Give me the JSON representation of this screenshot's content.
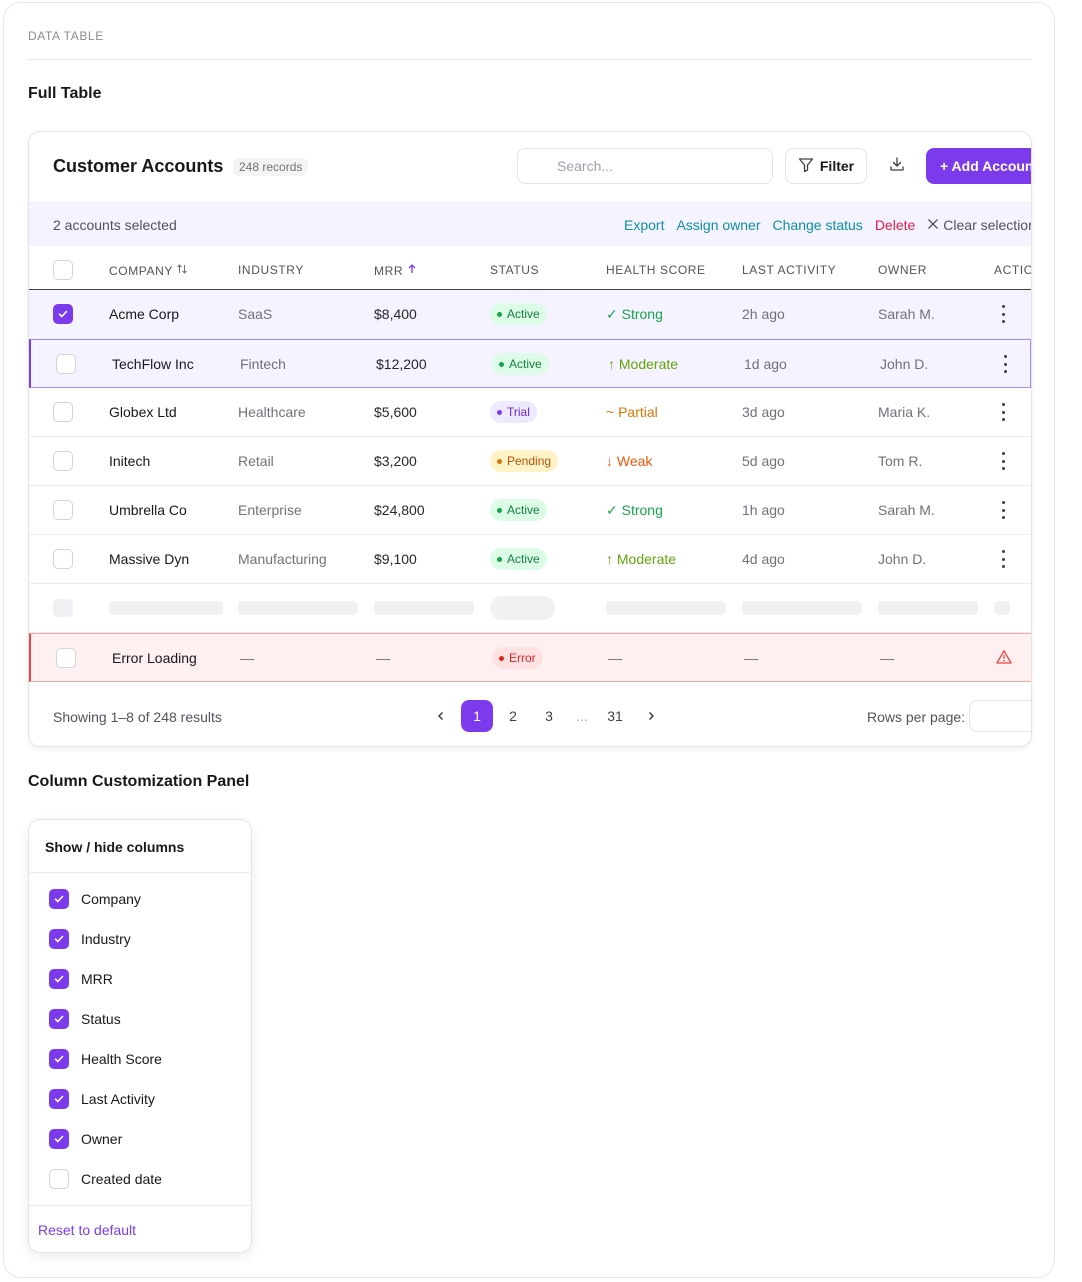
{
  "section": {
    "label": "DATA TABLE"
  },
  "full_table": {
    "heading": "Full Table",
    "title": "Customer Accounts",
    "records": "248 records",
    "search_placeholder": "Search...",
    "filter_label": "Filter",
    "add_label": "+ Add Account"
  },
  "bulk": {
    "count": "2 accounts selected",
    "export": "Export",
    "assign": "Assign owner",
    "change_status": "Change status",
    "delete": "Delete",
    "clear": "Clear selection"
  },
  "columns": {
    "company": "COMPANY",
    "industry": "INDUSTRY",
    "mrr": "MRR",
    "status": "STATUS",
    "health": "HEALTH SCORE",
    "last_activity": "LAST ACTIVITY",
    "owner": "OWNER",
    "actions": "ACTIONS"
  },
  "rows": [
    {
      "company": "Acme Corp",
      "industry": "SaaS",
      "mrr": "$8,400",
      "status": "Active",
      "health": "Strong",
      "last": "2h ago",
      "owner": "Sarah M."
    },
    {
      "company": "TechFlow Inc",
      "industry": "Fintech",
      "mrr": "$12,200",
      "status": "Active",
      "health": "Moderate",
      "last": "1d ago",
      "owner": "John D."
    },
    {
      "company": "Globex Ltd",
      "industry": "Healthcare",
      "mrr": "$5,600",
      "status": "Trial",
      "health": "Partial",
      "last": "3d ago",
      "owner": "Maria K."
    },
    {
      "company": "Initech",
      "industry": "Retail",
      "mrr": "$3,200",
      "status": "Pending",
      "health": "Weak",
      "last": "5d ago",
      "owner": "Tom R."
    },
    {
      "company": "Umbrella Co",
      "industry": "Enterprise",
      "mrr": "$24,800",
      "status": "Active",
      "health": "Strong",
      "last": "1h ago",
      "owner": "Sarah M."
    },
    {
      "company": "Massive Dyn",
      "industry": "Manufacturing",
      "mrr": "$9,100",
      "status": "Active",
      "health": "Moderate",
      "last": "4d ago",
      "owner": "John D."
    }
  ],
  "error_row": {
    "company": "Error Loading",
    "dash": "—",
    "status": "Error"
  },
  "footer": {
    "showing": "Showing 1–8 of 248 results",
    "pages": [
      "1",
      "2",
      "3",
      "...",
      "31"
    ],
    "rows_per_page": "Rows per page:"
  },
  "panel": {
    "heading": "Column Customization Panel",
    "title": "Show / hide columns",
    "options": [
      {
        "label": "Company",
        "checked": true
      },
      {
        "label": "Industry",
        "checked": true
      },
      {
        "label": "MRR",
        "checked": true
      },
      {
        "label": "Status",
        "checked": true
      },
      {
        "label": "Health Score",
        "checked": true
      },
      {
        "label": "Last Activity",
        "checked": true
      },
      {
        "label": "Owner",
        "checked": true
      },
      {
        "label": "Created date",
        "checked": false
      }
    ],
    "reset": "Reset to default"
  },
  "colors": {
    "accent": "#7c3aed",
    "teal": "#0e8fa6",
    "danger": "#e11d48"
  }
}
